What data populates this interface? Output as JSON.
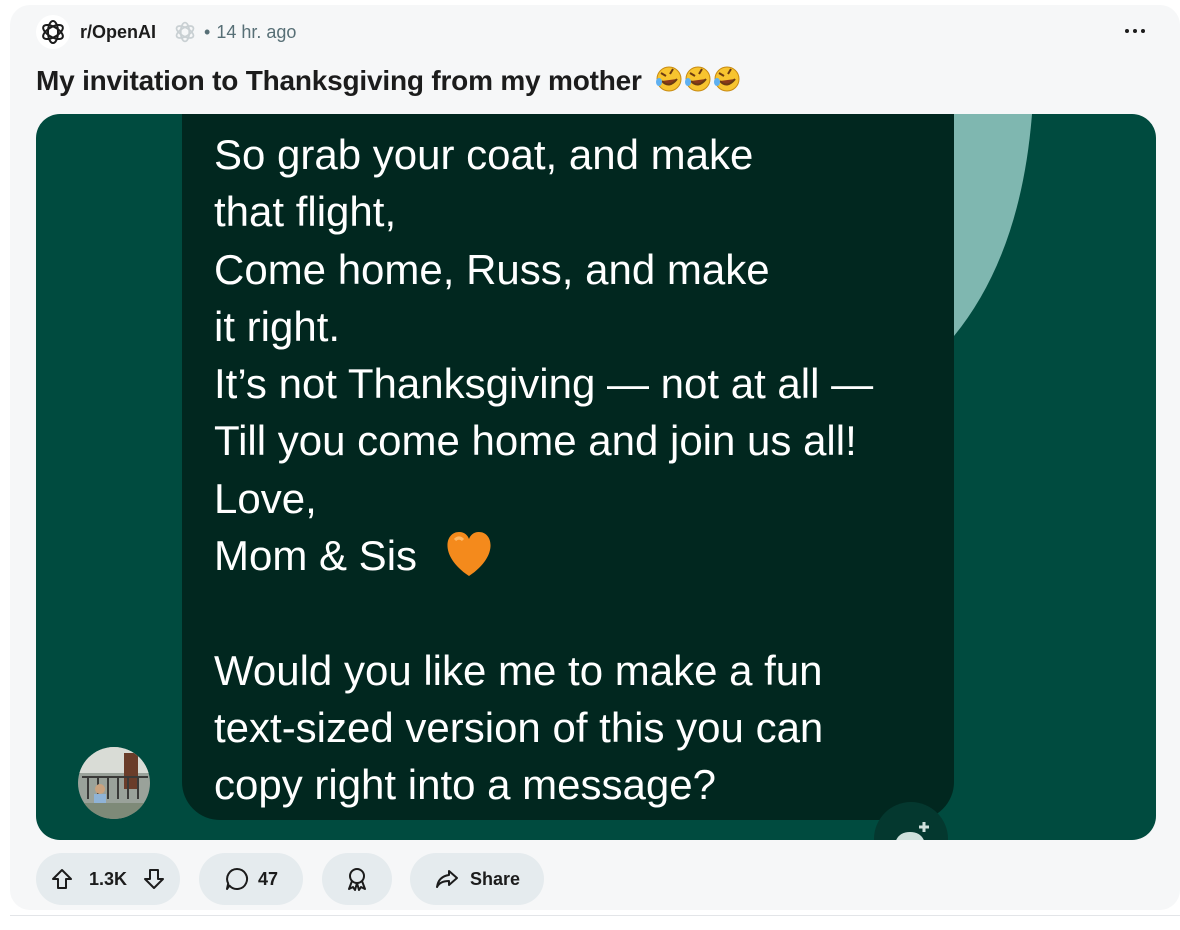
{
  "post": {
    "subreddit": "r/OpenAI",
    "dot": "•",
    "time": "14 hr. ago",
    "title": "My invitation to Thanksgiving from my mother",
    "title_emoji": "rolling-on-the-floor-laughing x3"
  },
  "image_text": {
    "lines": [
      "So grab your coat, and make",
      "that flight,",
      "Come home, Russ, and make",
      "it right.",
      "It’s not Thanksgiving — not at all —",
      "Till you come home and join us all!",
      "Love,",
      "Mom & Sis"
    ],
    "heart_emoji": "orange-heart",
    "question_lines": [
      "Would you like me to make a fun",
      "text-sized version of this you can",
      "copy right into a message?"
    ]
  },
  "actions": {
    "upvotes": "1.3K",
    "comments": "47",
    "share_label": "Share"
  },
  "colors": {
    "card_bg": "#f6f7f8",
    "image_bg": "#004b3f",
    "bubble_bg": "#01271f",
    "accent_shape": "#7fb7b0",
    "pill_bg": "#e5ebee",
    "meta_text": "#576f76"
  },
  "icons": {
    "subreddit_avatar": "openai-logo-icon",
    "badge": "openai-logo-icon",
    "menu": "more-horizontal-icon",
    "upvote": "arrow-up-icon",
    "downvote": "arrow-down-icon",
    "comment": "comment-bubble-icon",
    "award": "award-icon",
    "share": "share-arrow-icon"
  }
}
